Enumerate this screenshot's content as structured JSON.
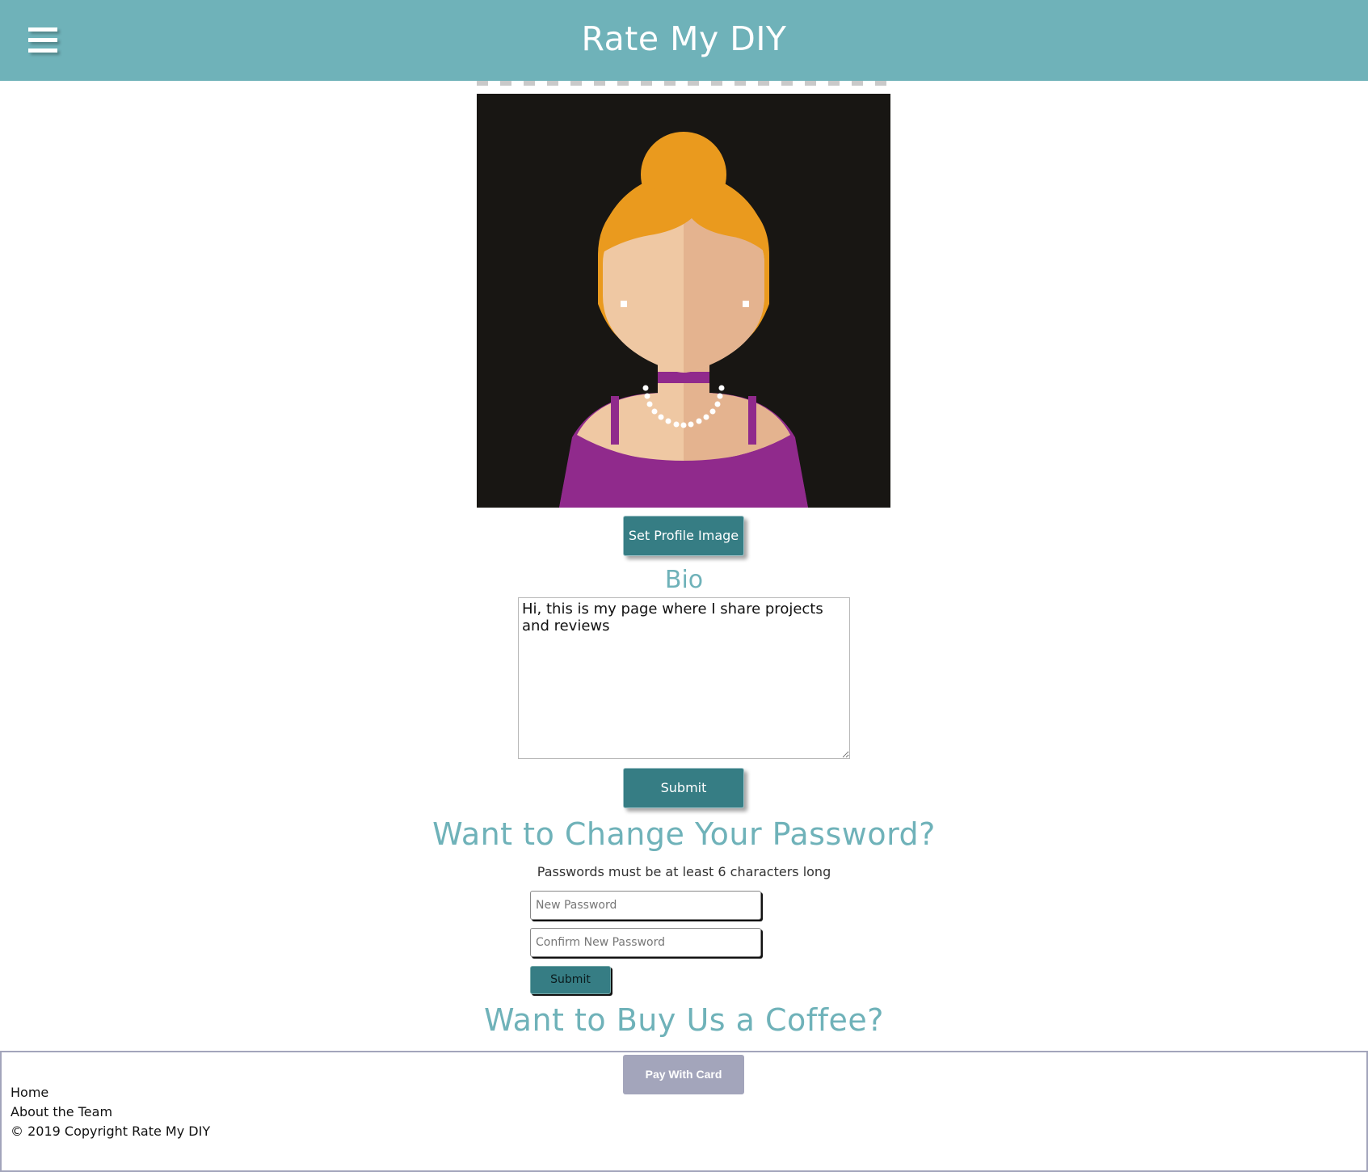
{
  "header": {
    "title": "Rate My DIY",
    "menu_icon": "hamburger-menu-icon",
    "background_color": "#6fb2b9"
  },
  "profile": {
    "image": "female-avatar-illustration",
    "set_image_label": "Set Profile Image"
  },
  "bio": {
    "heading": "Bio",
    "text": "Hi, this is my page where I share projects and reviews",
    "submit_label": "Submit"
  },
  "password": {
    "heading": "Want to Change Your Password?",
    "note": "Passwords must be at least 6 characters long",
    "new_placeholder": "New Password",
    "confirm_placeholder": "Confirm New Password",
    "submit_label": "Submit"
  },
  "coffee": {
    "heading": "Want to Buy Us a Coffee?",
    "pay_label": "Pay With Card"
  },
  "footer": {
    "links": [
      "Home",
      "About the Team"
    ],
    "copyright": "© 2019 Copyright Rate My DIY"
  },
  "colors": {
    "accent": "#6fb2b9",
    "button": "#367d84",
    "pay_button": "#a3a5bb"
  }
}
